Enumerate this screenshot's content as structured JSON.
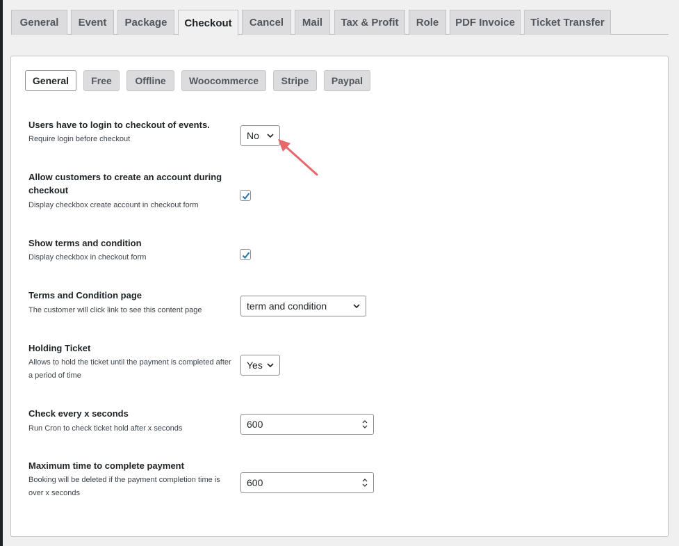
{
  "main_tabs": [
    {
      "label": "General"
    },
    {
      "label": "Event"
    },
    {
      "label": "Package"
    },
    {
      "label": "Checkout",
      "active": true
    },
    {
      "label": "Cancel"
    },
    {
      "label": "Mail"
    },
    {
      "label": "Tax & Profit"
    },
    {
      "label": "Role"
    },
    {
      "label": "PDF Invoice"
    },
    {
      "label": "Ticket Transfer"
    }
  ],
  "sub_tabs": [
    {
      "label": "General",
      "active": true
    },
    {
      "label": "Free"
    },
    {
      "label": "Offline"
    },
    {
      "label": "Woocommerce"
    },
    {
      "label": "Stripe"
    },
    {
      "label": "Paypal"
    }
  ],
  "settings": {
    "require_login": {
      "title": "Users have to login to checkout of events.",
      "desc": "Require login before checkout",
      "value": "No"
    },
    "create_account": {
      "title": "Allow customers to create an account during checkout",
      "desc": "Display checkbox create account in checkout form",
      "checked": true
    },
    "show_terms": {
      "title": "Show terms and condition",
      "desc": "Display checkbox in checkout form",
      "checked": true
    },
    "terms_page": {
      "title": "Terms and Condition page",
      "desc": "The customer will click link to see this content page",
      "value": "term and condition"
    },
    "holding_ticket": {
      "title": "Holding Ticket",
      "desc": "Allows to hold the ticket until the payment is completed after a period of time",
      "value": "Yes"
    },
    "check_every": {
      "title": "Check every x seconds",
      "desc": "Run Cron to check ticket hold after x seconds",
      "value": "600"
    },
    "max_time": {
      "title": "Maximum time to complete payment",
      "desc": "Booking will be deleted if the payment completion time is over x seconds",
      "value": "600"
    }
  },
  "colors": {
    "accent_checkbox": "#2271b1",
    "annotation_arrow": "#e8676b"
  }
}
